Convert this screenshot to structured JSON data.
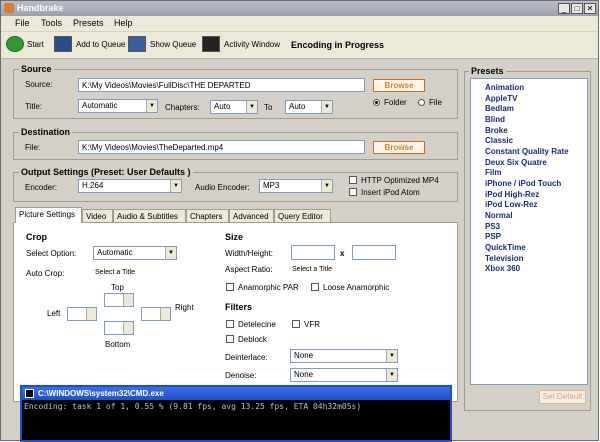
{
  "window": {
    "title": "Handbrake"
  },
  "menu": [
    "File",
    "Tools",
    "Presets",
    "Help"
  ],
  "toolbar": {
    "start": "Start",
    "add_queue": "Add to Queue",
    "show_queue": "Show Queue",
    "activity": "Activity Window",
    "status": "Encoding in Progress"
  },
  "source": {
    "heading": "Source",
    "source_label": "Source:",
    "source_value": "K:\\My Videos\\Movies\\FullDisc\\THE DEPARTED",
    "browse": "Browse",
    "title_label": "Title:",
    "title_value": "Automatic",
    "chapters_label": "Chapters:",
    "chapter_from": "Auto",
    "to_label": "To",
    "chapter_to": "Auto",
    "folder_label": "Folder",
    "file_label": "File"
  },
  "destination": {
    "heading": "Destination",
    "file_label": "File:",
    "file_value": "K:\\My Videos\\Movies\\TheDeparted.mp4",
    "browse": "Browse"
  },
  "output": {
    "heading": "Output Settings (Preset: User Defaults )",
    "encoder_label": "Encoder:",
    "encoder_value": "H.264",
    "audio_label": "Audio Encoder:",
    "audio_value": "MP3",
    "http_label": "HTTP Optimized MP4",
    "ipod_label": "Insert iPod Atom"
  },
  "tabs": [
    "Picture Settings",
    "Video",
    "Audio & Subtitles",
    "Chapters",
    "Advanced",
    "Query Editor"
  ],
  "picture": {
    "crop_heading": "Crop",
    "select_label": "Select Option:",
    "select_value": "Automatic",
    "autocrop_label": "Auto Crop:",
    "autocrop_value": "Select a Title",
    "top": "Top",
    "left": "Left",
    "right": "Right",
    "bottom": "Bottom",
    "size_heading": "Size",
    "wh_label": "Width/Height:",
    "x": "x",
    "aspect_label": "Aspect Ratio:",
    "aspect_value": "Select a Title",
    "anamorphic": "Anamorphic PAR",
    "loose": "Loose Anamorphic",
    "filters_heading": "Filters",
    "detelecine": "Detelecine",
    "vfr": "VFR",
    "deblock": "Deblock",
    "deinterlace_label": "Deinterlace:",
    "deinterlace_value": "None",
    "denoise_label": "Denoise:",
    "denoise_value": "None"
  },
  "presets": {
    "heading": "Presets",
    "items": [
      "Animation",
      "AppleTV",
      "Bedlam",
      "Blind",
      "Broke",
      "Classic",
      "Constant Quality Rate",
      "Deux Six Quatre",
      "Film",
      "iPhone / iPod Touch",
      "iPod High-Rez",
      "iPod Low-Rez",
      "Normal",
      "PS3",
      "PSP",
      "QuickTime",
      "Television",
      "Xbox 360"
    ],
    "set_default": "Set Default"
  },
  "cmd": {
    "title": "C:\\WINDOWS\\system32\\CMD.exe",
    "text": "Encoding: task 1 of 1, 0.55 % (9.81 fps, avg 13.25 fps, ETA 04h32m05s)"
  },
  "colors": {
    "accent_orange": "#e07a2a",
    "preset_text": "#1a2a7a",
    "cmd_title": "#1c50c8"
  }
}
